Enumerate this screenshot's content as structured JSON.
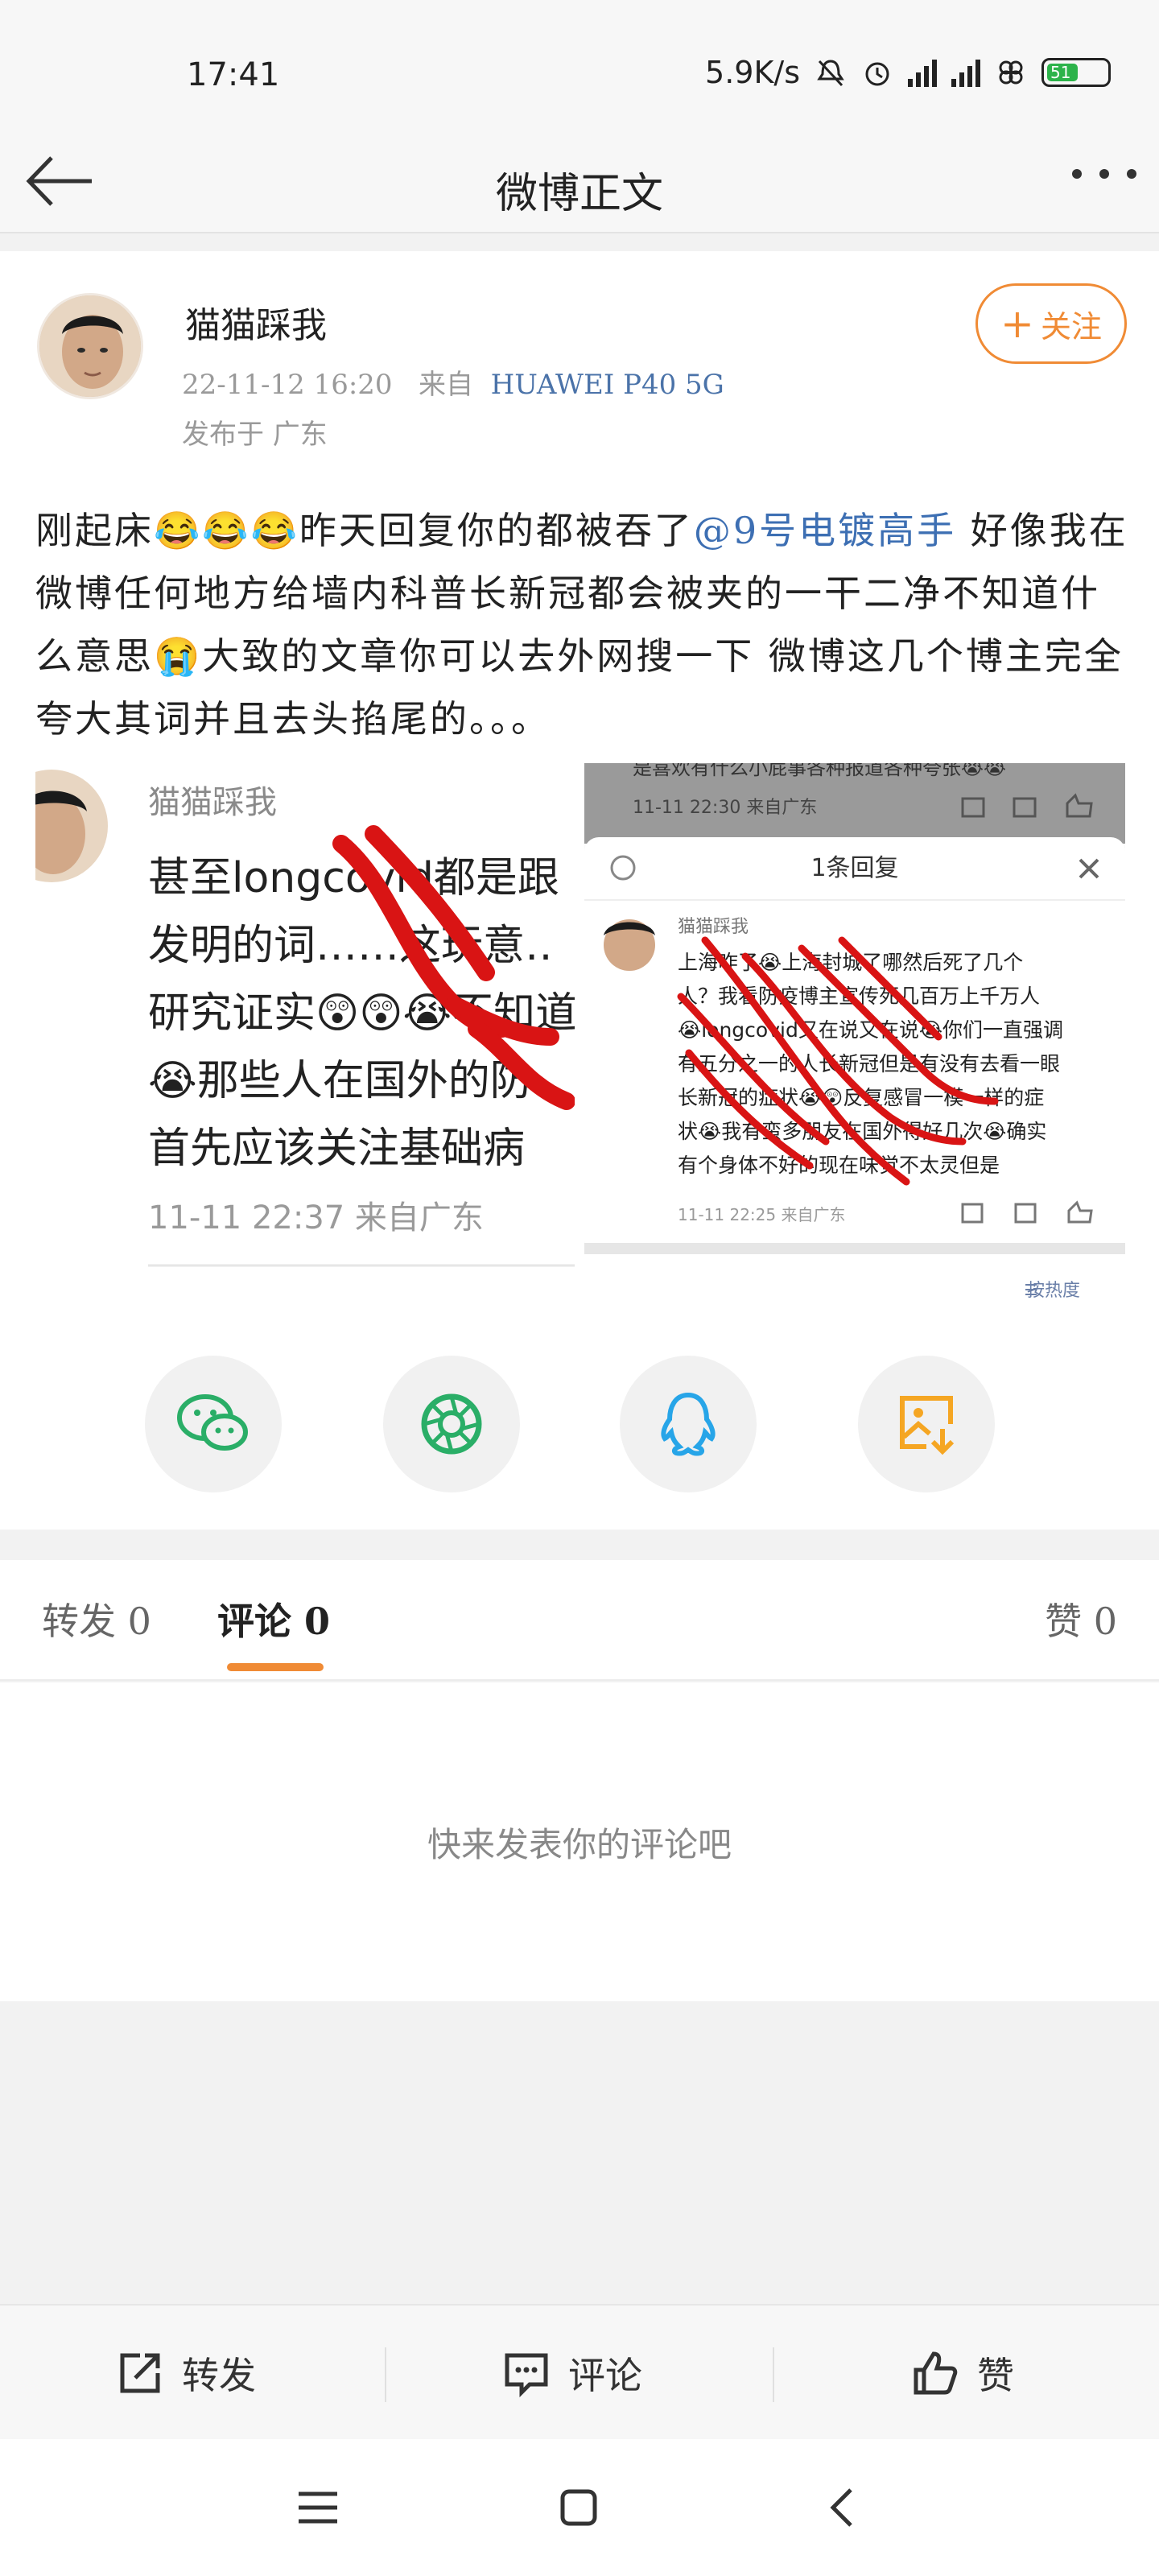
{
  "status_bar": {
    "time": "17:41",
    "speed": "5.9K/s",
    "battery_level": "51",
    "battery_fraction": 0.51
  },
  "nav": {
    "title": "微博正文"
  },
  "post": {
    "username": "猫猫踩我",
    "timestamp": "22-11-12 16:20",
    "source_prefix": "来自",
    "device": "HUAWEI P40 5G",
    "location": "发布于 广东",
    "follow_label": "关注",
    "text_part1": "刚起床😂😂😂昨天回复你的都被吞了",
    "mention": "@9号电镀高手",
    "text_part2": " 好像我在微博任何地方给墙内科普长新冠都会被夹的一干二净不知道什么意思😭大致的文章你可以去外网搜一下 微博这几个博主完全夸大其词并且去头掐尾的。。。"
  },
  "image_left": {
    "username": "猫猫踩我",
    "lines": [
      "甚至longcovid都是跟",
      "发明的词……这玩意‥",
      "研究证实😲😲😭不知道",
      "😭那些人在国外的防",
      "首先应该关注基础病"
    ],
    "footer": "11-11 22:37  来自广东"
  },
  "image_right": {
    "top_text": "是喜欢有什么小屁事各种报道各种夸张😭😭",
    "top_footer": "11-11 22:30  来自广东",
    "dialog_title": "1条回复",
    "reply_user": "猫猫踩我",
    "reply_lines": [
      "上海咋了😭上海封城了哪然后死了几个",
      "人？我看防疫博主宣传死几百万上千万人",
      "😭longcovid又在说又在说😭你们一直强调",
      "有五分之一的人长新冠但是有没有去看一眼",
      "长新冠的症状😭😲反复感冒一模一样的症",
      "状😭我有蛮多朋友在国外得好几次😭确实",
      "有个身体不好的现在味觉不太灵但是"
    ],
    "reply_footer": "11-11 22:25  来自广东",
    "sort_label": "按热度"
  },
  "share": {
    "items": [
      {
        "name": "wechat",
        "color": "#2aae67"
      },
      {
        "name": "moments",
        "color": "#2aae67"
      },
      {
        "name": "qq",
        "color": "#27a5e8"
      },
      {
        "name": "save-image",
        "color": "#f5a623"
      }
    ]
  },
  "tabs": {
    "repost": "转发 0",
    "comment": "评论 0",
    "like": "赞 0"
  },
  "comments": {
    "empty_hint": "快来发表你的评论吧"
  },
  "actions": {
    "repost": "转发",
    "comment": "评论",
    "like": "赞"
  },
  "colors": {
    "accent": "#f08b35",
    "link": "#3d6fb3"
  }
}
